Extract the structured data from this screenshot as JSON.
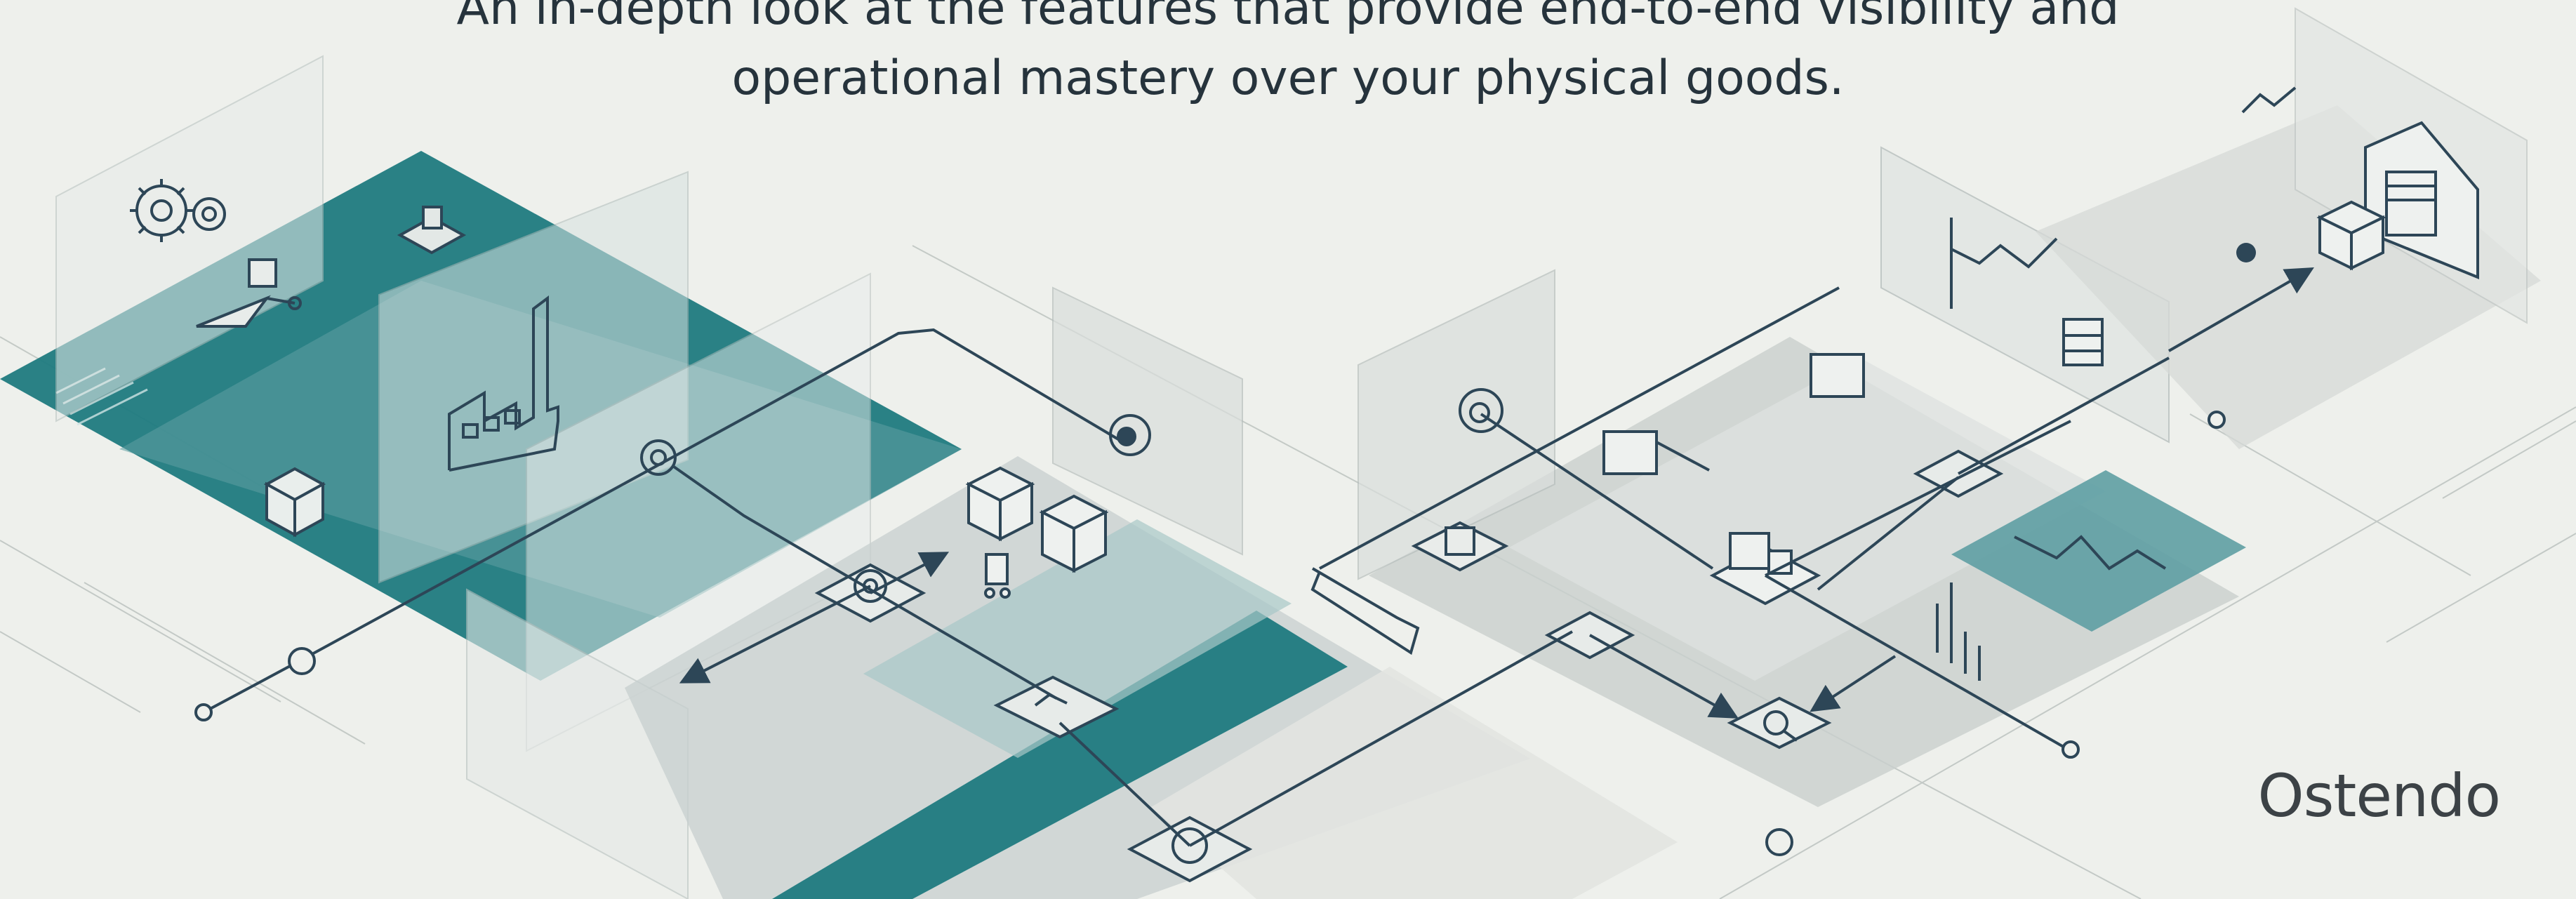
{
  "header": {
    "subtitle_line1": "An in-depth look at the features that provide end-to-end visibility and",
    "subtitle_line2": "operational mastery over your physical goods."
  },
  "brand": {
    "logo_text": "Ostendo"
  },
  "colors": {
    "background": "#eef0ec",
    "teal_dark": "#1f7a80",
    "teal_mid": "#5e9ea3",
    "teal_light": "#bcd3d4",
    "gray_panel": "#dcdfdc",
    "line": "#2d4657",
    "text": "#26333c"
  },
  "icons": [
    "gears-icon",
    "factory-icon",
    "box-icon",
    "drone-icon",
    "conveyor-gear-icon",
    "stacked-boxes-icon",
    "trolley-icon",
    "target-icon",
    "truck-icon",
    "line-chart-icon",
    "bar-chart-icon",
    "warehouse-icon",
    "search-icon",
    "robot-arm-icon",
    "chat-icon"
  ]
}
